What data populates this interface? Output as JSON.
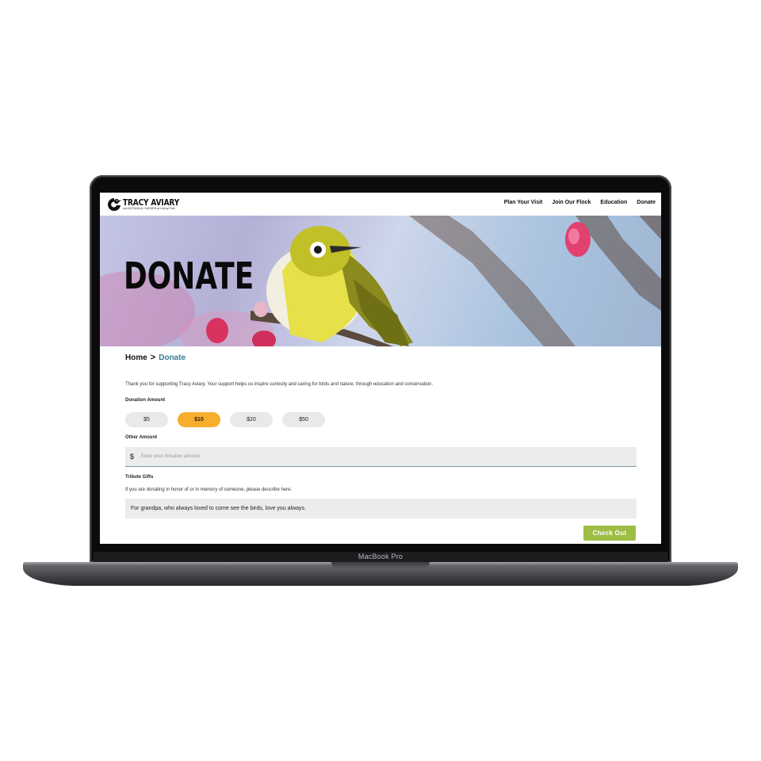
{
  "device": {
    "model_label": "MacBook Pro"
  },
  "site": {
    "logo": {
      "title": "TRACY AVIARY",
      "subtitle": "and BOTANICAL GARDEN at Liberty Park"
    },
    "nav": [
      "Plan Your Visit",
      "Join Our Flock",
      "Education",
      "Donate"
    ]
  },
  "hero": {
    "title": "DONATE"
  },
  "breadcrumb": {
    "home": "Home",
    "separator": ">",
    "current": "Donate"
  },
  "form": {
    "intro": "Thank you for supporting Tracy Aviary. Your support helps us inspire curiosity and caring for birds and nature, through education and conservation.",
    "donation_label": "Donation Amount",
    "amounts": [
      "$5",
      "$10",
      "$20",
      "$50"
    ],
    "selected_amount": "$10",
    "other_label": "Other Amount",
    "currency_symbol": "$",
    "other_placeholder": "Enter your donation amount",
    "other_value": "",
    "tribute_label": "Tribute Gifts",
    "tribute_hint": "If you are donating in honor of or in memory of someone, please describe here.",
    "tribute_value": "For grandpa, who always loved to come see the birds, love you always.",
    "checkout_label": "Check Out"
  },
  "colors": {
    "selected_amount": "#f7ae2f",
    "checkout": "#9dbd44",
    "breadcrumb_current": "#3a7a8c",
    "input_background": "#ececec"
  }
}
